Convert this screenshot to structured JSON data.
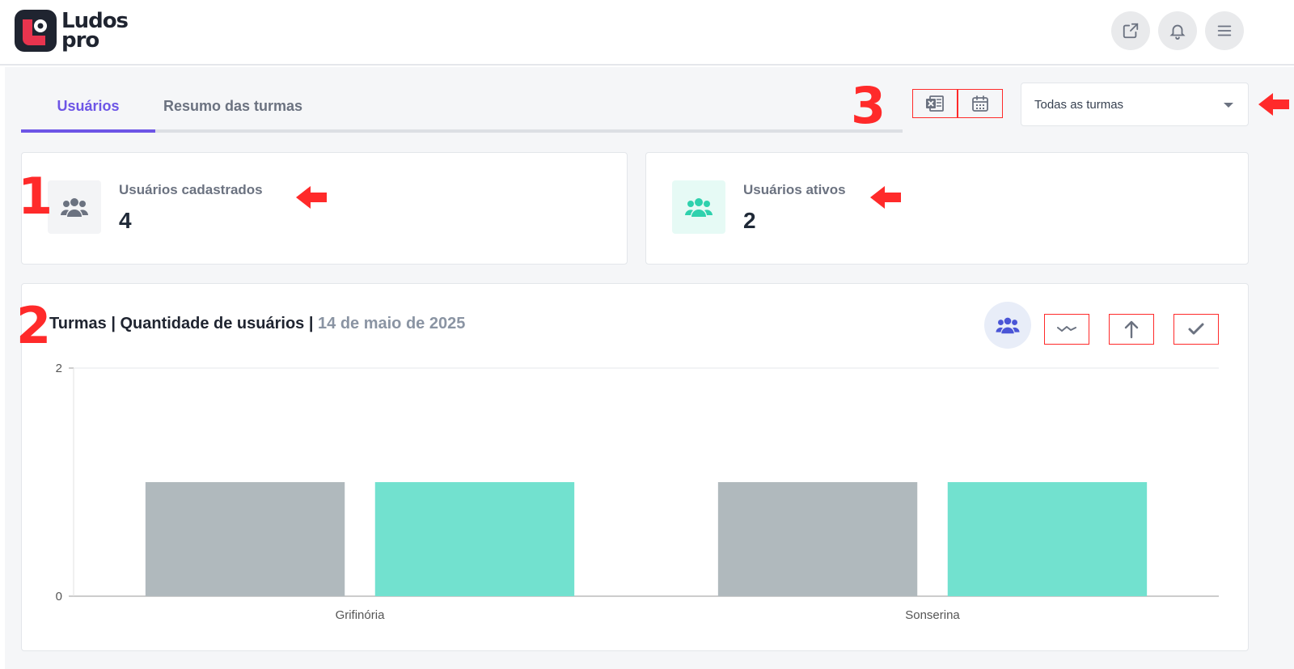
{
  "header": {
    "logo_line1": "Ludos",
    "logo_line2": "pro",
    "buttons": [
      "external-link-icon",
      "bell-icon",
      "menu-icon"
    ]
  },
  "tabs": [
    {
      "label": "Usuários",
      "active": true
    },
    {
      "label": "Resumo das turmas",
      "active": false
    }
  ],
  "annotations": {
    "n1": "1",
    "n2": "2",
    "n3": "3",
    "color": "#ff2a2a"
  },
  "toolbar": {
    "icons": [
      "excel-export-icon",
      "calendar-icon"
    ]
  },
  "filter": {
    "selected": "Todas as turmas"
  },
  "stats": [
    {
      "label": "Usuários cadastrados",
      "value": "4",
      "icon": "users-icon",
      "color": "#6b7280"
    },
    {
      "label": "Usuários ativos",
      "value": "2",
      "icon": "users-icon",
      "color": "#2fd1ad"
    }
  ],
  "chart": {
    "title_main": "Turmas | Quantidade de usuários | ",
    "title_date": "14 de maio de 2025",
    "controls": [
      "users-icon",
      "trend-icon",
      "arrow-up-icon",
      "check-icon"
    ]
  },
  "chart_data": {
    "type": "bar",
    "categories": [
      "Grifinória",
      "Sonserina"
    ],
    "series": [
      {
        "values": [
          1,
          1
        ],
        "color": "#b0b9bd"
      },
      {
        "values": [
          1,
          1
        ],
        "color": "#72e1cf"
      }
    ],
    "ylim": [
      0,
      2
    ],
    "yticks": [
      0,
      2
    ],
    "grid": true
  }
}
